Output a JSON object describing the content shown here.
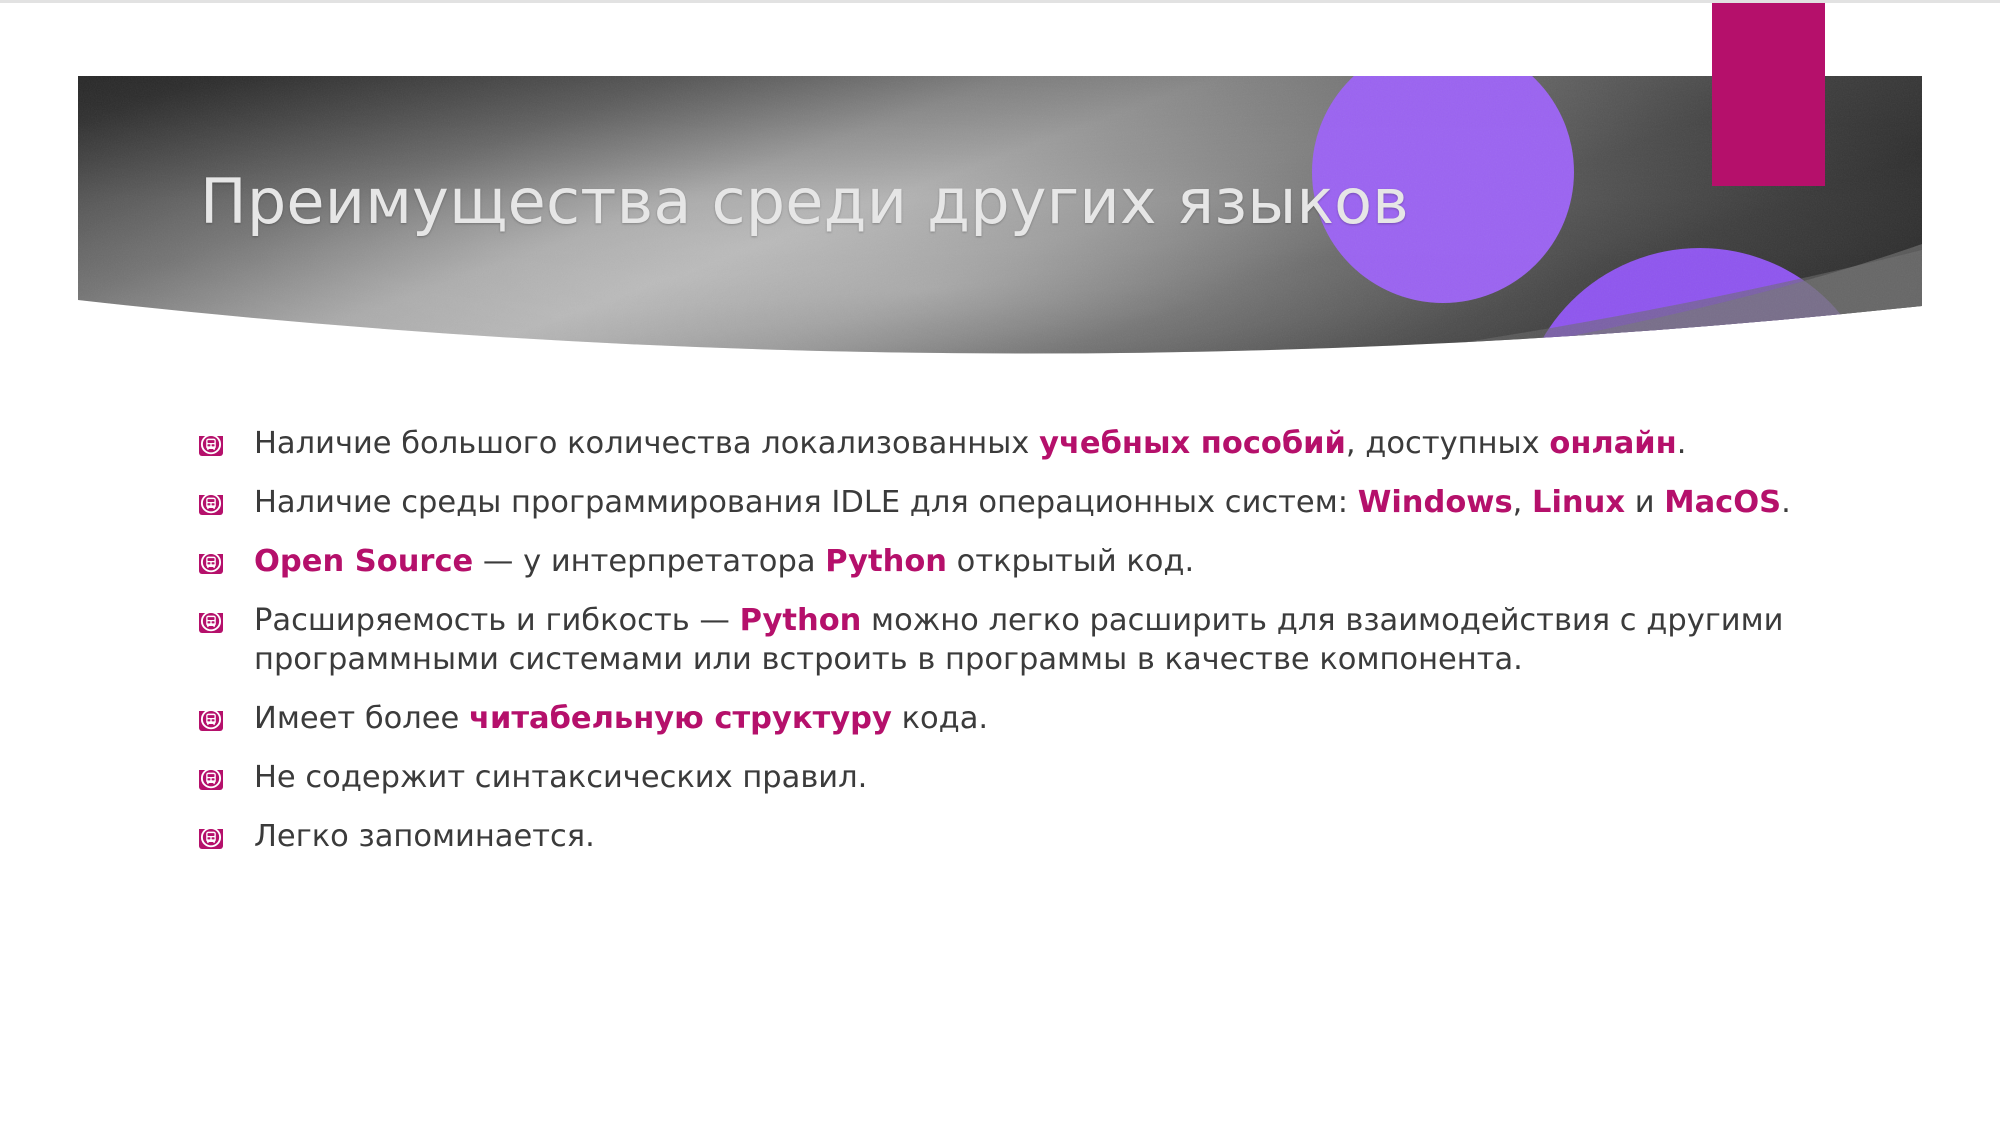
{
  "slide": {
    "title": "Преимущества среди других языков",
    "language": "ru"
  },
  "colors": {
    "accent_magenta": "#b5106b",
    "highlight_text": "#b5106b",
    "body_text": "#3b3b3b",
    "title_text": "#e6e6e6",
    "decor_purple": "#9b63f2",
    "decor_purple_light": "#ab7ef5",
    "banner_dark": "#2b2b2b",
    "banner_light": "#b4b4b4",
    "background": "#ffffff"
  },
  "decor": {
    "accent_bar_name": "magenta-accent-bar",
    "circle_top_name": "purple-circle-top",
    "circle_bottom_name": "purple-circle-bottom",
    "wave_name": "purple-wave-band"
  },
  "bullets": [
    {
      "icon": "bus-badge-bullet-icon",
      "parts": [
        {
          "text": "Наличие большого количества локализованных ",
          "highlight": false
        },
        {
          "text": "учебных пособий",
          "highlight": true
        },
        {
          "text": ", доступных ",
          "highlight": false
        },
        {
          "text": "онлайн",
          "highlight": true
        },
        {
          "text": ".",
          "highlight": false
        }
      ]
    },
    {
      "icon": "bus-badge-bullet-icon",
      "parts": [
        {
          "text": "Наличие среды программирования IDLE для операционных систем: ",
          "highlight": false
        },
        {
          "text": "Windows",
          "highlight": true
        },
        {
          "text": ", ",
          "highlight": false
        },
        {
          "text": "Linux",
          "highlight": true
        },
        {
          "text": " и ",
          "highlight": false
        },
        {
          "text": "MacOS",
          "highlight": true
        },
        {
          "text": ".",
          "highlight": false
        }
      ]
    },
    {
      "icon": "bus-badge-bullet-icon",
      "parts": [
        {
          "text": "Open Source",
          "highlight": true
        },
        {
          "text": " — у интерпретатора ",
          "highlight": false
        },
        {
          "text": "Python",
          "highlight": true
        },
        {
          "text": " открытый код.",
          "highlight": false
        }
      ]
    },
    {
      "icon": "bus-badge-bullet-icon",
      "parts": [
        {
          "text": "Расширяемость и гибкость — ",
          "highlight": false
        },
        {
          "text": "Python",
          "highlight": true
        },
        {
          "text": " можно легко расширить для взаимодействия с другими программными системами или встроить в программы в качестве компонента.",
          "highlight": false
        }
      ]
    },
    {
      "icon": "bus-badge-bullet-icon",
      "parts": [
        {
          "text": "Имеет более ",
          "highlight": false
        },
        {
          "text": "читабельную структуру",
          "highlight": true
        },
        {
          "text": " кода.",
          "highlight": false
        }
      ]
    },
    {
      "icon": "bus-badge-bullet-icon",
      "parts": [
        {
          "text": "Не содержит синтаксических правил.",
          "highlight": false
        }
      ]
    },
    {
      "icon": "bus-badge-bullet-icon",
      "parts": [
        {
          "text": "Легко запоминается.",
          "highlight": false
        }
      ]
    }
  ]
}
